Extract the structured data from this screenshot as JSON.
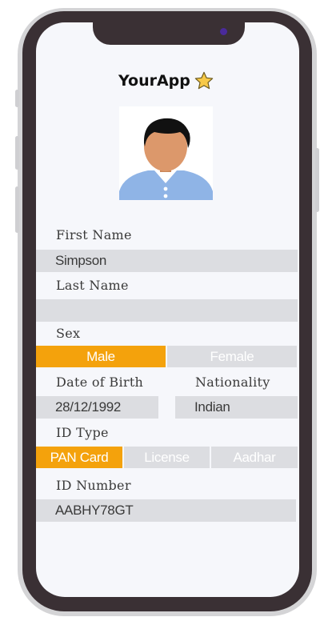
{
  "app": {
    "title": "YourApp",
    "title_icon": "star-icon",
    "accent_color": "#f4a20c",
    "inactive_color": "#dcdde1"
  },
  "form": {
    "first_name": {
      "label": "First Name",
      "value": "Simpson"
    },
    "last_name": {
      "label": "Last Name",
      "value": ""
    },
    "sex": {
      "label": "Sex",
      "options": [
        "Male",
        "Female"
      ],
      "selected": "Male"
    },
    "dob": {
      "label": "Date of Birth",
      "value": "28/12/1992"
    },
    "nationality": {
      "label": "Nationality",
      "value": "Indian"
    },
    "id_type": {
      "label": "ID Type",
      "options": [
        "PAN Card",
        "License",
        "Aadhar"
      ],
      "selected": "PAN Card"
    },
    "id_number": {
      "label": "ID Number",
      "value": "AABHY78GT"
    }
  }
}
